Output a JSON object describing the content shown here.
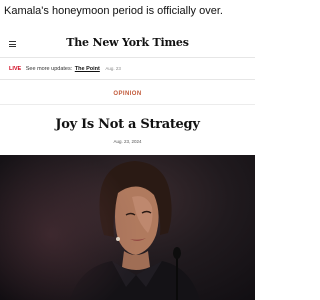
{
  "post": {
    "text": "Kamala's honeymoon period is officially over."
  },
  "article": {
    "publication": "The New York Times",
    "live": {
      "label": "LIVE",
      "text": "See more updates:",
      "link": "The Point",
      "date": "Aug. 23"
    },
    "section": "OPINION",
    "headline": "Joy Is Not a Strategy",
    "date": "Aug. 23, 2024"
  },
  "colors": {
    "live_red": "#d0021b",
    "section_orange": "#c25a3a",
    "photo_background": "#1a1518"
  },
  "icons": {
    "menu": "hamburger-menu-icon"
  }
}
